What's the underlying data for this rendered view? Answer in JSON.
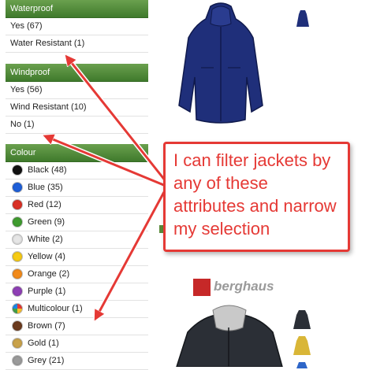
{
  "filters": {
    "waterproof": {
      "title": "Waterproof",
      "options": [
        {
          "label": "Yes (67)"
        },
        {
          "label": "Water Resistant (1)"
        }
      ]
    },
    "windproof": {
      "title": "Windproof",
      "options": [
        {
          "label": "Yes (56)"
        },
        {
          "label": "Wind Resistant (10)"
        },
        {
          "label": "No (1)"
        }
      ]
    },
    "colour": {
      "title": "Colour",
      "options": [
        {
          "label": "Black (48)",
          "color": "#111111"
        },
        {
          "label": "Blue (35)",
          "color": "#1e5fd8"
        },
        {
          "label": "Red (12)",
          "color": "#d93025"
        },
        {
          "label": "Green (9)",
          "color": "#3f9b2f"
        },
        {
          "label": "White (2)",
          "color": "#e6e6e6"
        },
        {
          "label": "Yellow (4)",
          "color": "#f6cb14"
        },
        {
          "label": "Orange (2)",
          "color": "#f28a1a"
        },
        {
          "label": "Purple (1)",
          "color": "#8e3fb5"
        },
        {
          "label": "Multicolour (1)",
          "color": "multi"
        },
        {
          "label": "Brown (7)",
          "color": "#6b3a1e"
        },
        {
          "label": "Gold (1)",
          "color": "#c9a24a"
        },
        {
          "label": "Grey (21)",
          "color": "#9a9a9a"
        }
      ]
    }
  },
  "callout": {
    "text": "I can filter jackets by any of these attributes and narrow my selection"
  },
  "brand": {
    "name": "berghaus"
  },
  "colors": {
    "header_green": "#4e8a37",
    "callout_red": "#e53935"
  }
}
